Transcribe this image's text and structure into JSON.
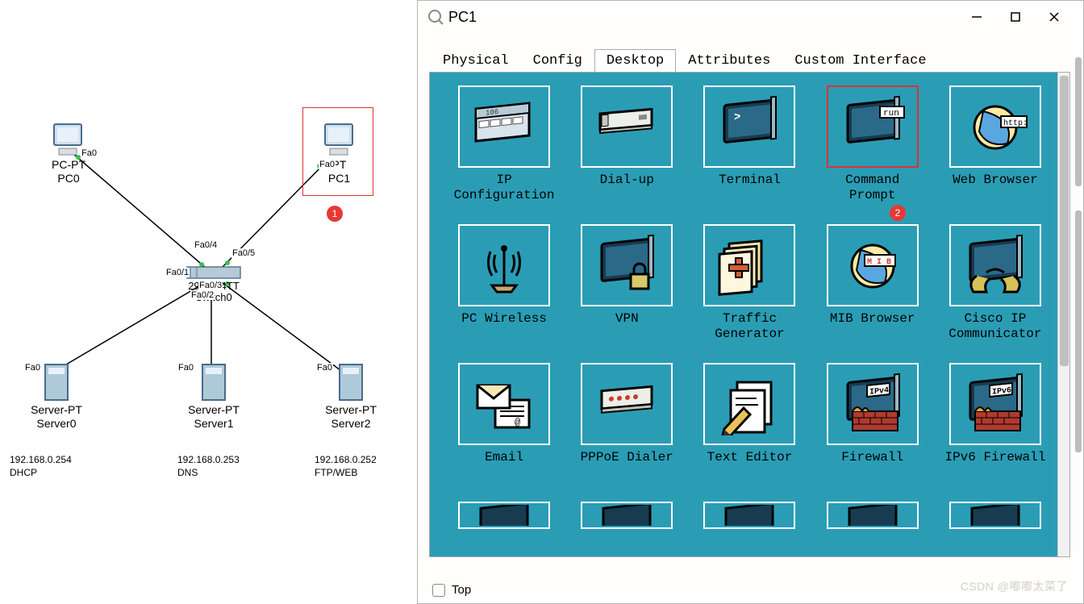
{
  "window": {
    "title": "PC1",
    "tabs": [
      "Physical",
      "Config",
      "Desktop",
      "Attributes",
      "Custom Interface"
    ],
    "active_tab": 2,
    "footer_label": "Top",
    "watermark": "CSDN @嘟嘟太菜了"
  },
  "apps": [
    {
      "id": "ip-configuration",
      "label": "IP\nConfiguration",
      "icon": "ipconf"
    },
    {
      "id": "dial-up",
      "label": "Dial-up",
      "icon": "dialup"
    },
    {
      "id": "terminal",
      "label": "Terminal",
      "icon": "terminal"
    },
    {
      "id": "command-prompt",
      "label": "Command\nPrompt",
      "icon": "cmd",
      "highlight": true
    },
    {
      "id": "web-browser",
      "label": "Web Browser",
      "icon": "browser"
    },
    {
      "id": "pc-wireless",
      "label": "PC Wireless",
      "icon": "wireless"
    },
    {
      "id": "vpn",
      "label": "VPN",
      "icon": "vpn"
    },
    {
      "id": "traffic-generator",
      "label": "Traffic\nGenerator",
      "icon": "traffic"
    },
    {
      "id": "mib-browser",
      "label": "MIB Browser",
      "icon": "mib"
    },
    {
      "id": "cisco-ip-communicator",
      "label": "Cisco IP\nCommunicator",
      "icon": "cipc"
    },
    {
      "id": "email",
      "label": "Email",
      "icon": "email"
    },
    {
      "id": "pppoe-dialer",
      "label": "PPPoE Dialer",
      "icon": "pppoe"
    },
    {
      "id": "text-editor",
      "label": "Text Editor",
      "icon": "text"
    },
    {
      "id": "firewall",
      "label": "Firewall",
      "icon": "fw4"
    },
    {
      "id": "ipv6-firewall",
      "label": "IPv6 Firewall",
      "icon": "fw6"
    }
  ],
  "badges": {
    "topology": "1",
    "command_prompt": "2"
  },
  "topology": {
    "devices": {
      "pc0": {
        "type": "PC-PT",
        "name": "PC0",
        "iface": "Fa0"
      },
      "pc1": {
        "type": "PT",
        "name": "PC1",
        "iface": "Fa0"
      },
      "switch": {
        "type": "2960-24TT",
        "name": "Switch0",
        "ports": [
          "Fa0/1",
          "Fa0/2",
          "Fa0/3",
          "Fa0/4",
          "Fa0/5"
        ]
      },
      "server0": {
        "type": "Server-PT",
        "name": "Server0",
        "iface": "Fa0"
      },
      "server1": {
        "type": "Server-PT",
        "name": "Server1",
        "iface": "Fa0"
      },
      "server2": {
        "type": "Server-PT",
        "name": "Server2",
        "iface": "Fa0"
      }
    },
    "annotations": {
      "server0": {
        "ip": "192.168.0.254",
        "role": "DHCP"
      },
      "server1": {
        "ip": "192.168.0.253",
        "role": "DNS"
      },
      "server2": {
        "ip": "192.168.0.252",
        "role": "FTP/WEB"
      }
    }
  }
}
